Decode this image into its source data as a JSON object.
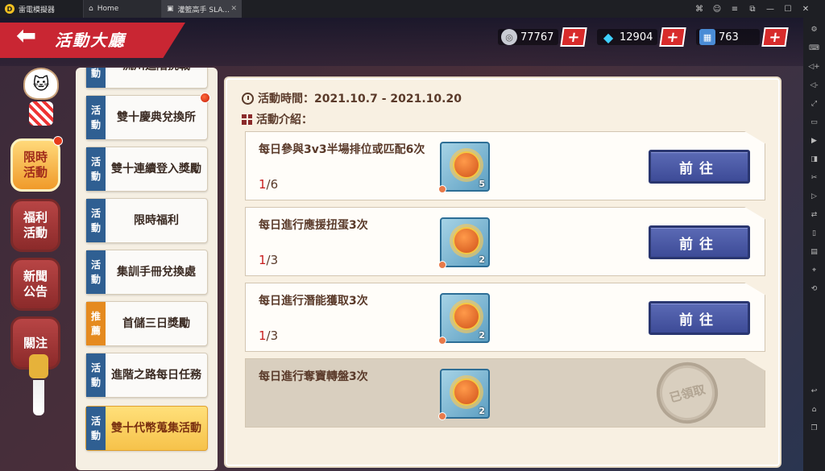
{
  "emulator": {
    "app_name": "雷電模擬器",
    "tabs": [
      {
        "label": "Home"
      },
      {
        "label": "灌籃高手 SLA..."
      }
    ]
  },
  "header": {
    "title": "活動大廳",
    "currencies": [
      {
        "value": "77767",
        "icon": "coin-icon"
      },
      {
        "value": "12904",
        "icon": "diamond-icon"
      },
      {
        "value": "763",
        "icon": "ticket-icon"
      }
    ]
  },
  "categories": [
    {
      "line1": "限時",
      "line2": "活動",
      "active": true
    },
    {
      "line1": "福利",
      "line2": "活動",
      "active": false
    },
    {
      "line1": "新聞",
      "line2": "公告",
      "active": false
    },
    {
      "line1": "關注",
      "line2": "",
      "active": false
    }
  ],
  "activity_list": [
    {
      "tag1": "活",
      "tag2": "動",
      "label": "流川進階挑戰"
    },
    {
      "tag1": "活",
      "tag2": "動",
      "label": "雙十慶典兌換所"
    },
    {
      "tag1": "活",
      "tag2": "動",
      "label": "雙十連續登入獎勵"
    },
    {
      "tag1": "活",
      "tag2": "動",
      "label": "限時福利"
    },
    {
      "tag1": "活",
      "tag2": "動",
      "label": "集訓手冊兌換處"
    },
    {
      "tag1": "推",
      "tag2": "薦",
      "label": "首儲三日獎勵"
    },
    {
      "tag1": "活",
      "tag2": "動",
      "label": "進階之路每日任務"
    },
    {
      "tag1": "活",
      "tag2": "動",
      "label": "雙十代幣蒐集活動"
    }
  ],
  "event": {
    "time_label": "活動時間：2021.10.7 - 2021.10.20",
    "intro_label": "活動介紹："
  },
  "tasks": [
    {
      "text": "每日參與3v3半場排位或匹配6次",
      "current": "1",
      "total": "/6",
      "reward_qty": "5",
      "button": "前往"
    },
    {
      "text": "每日進行應援扭蛋3次",
      "current": "1",
      "total": "/3",
      "reward_qty": "2",
      "button": "前往"
    },
    {
      "text": "每日進行潛能獲取3次",
      "current": "1",
      "total": "/3",
      "reward_qty": "2",
      "button": "前往"
    },
    {
      "text": "每日進行奪寶轉盤3次",
      "current": "",
      "total": "",
      "reward_qty": "2",
      "claimed": "已領取"
    }
  ]
}
